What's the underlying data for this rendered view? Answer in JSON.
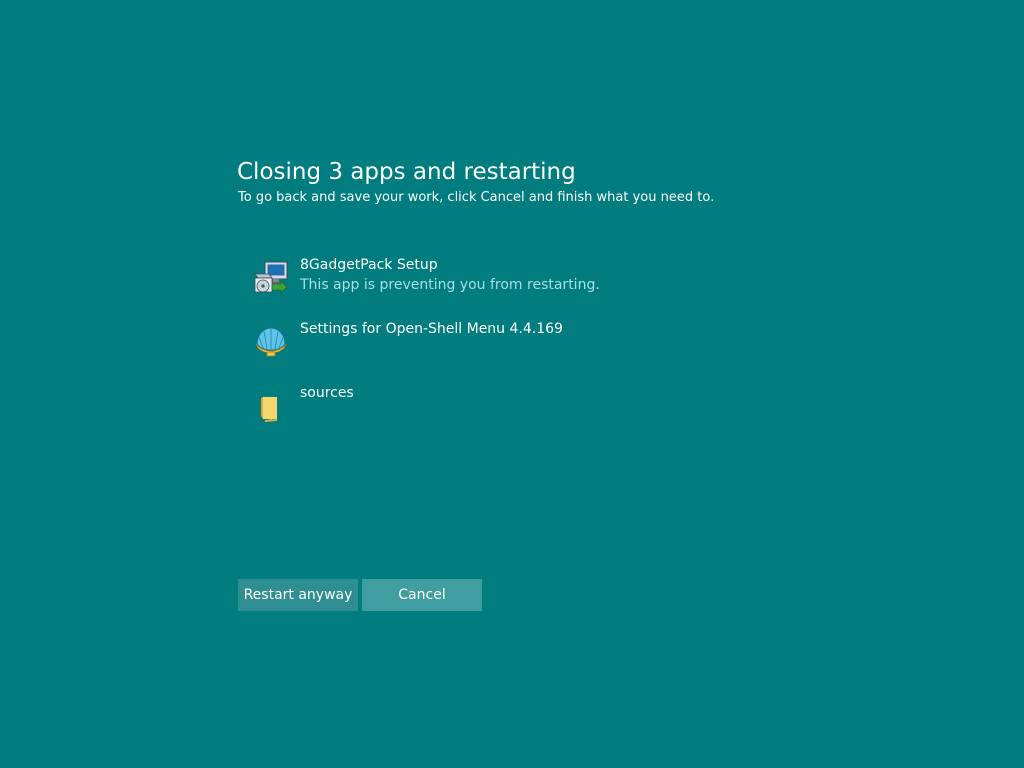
{
  "dialog": {
    "title": "Closing 3 apps and restarting",
    "subtitle": "To go back and save your work, click Cancel and finish what you need to."
  },
  "apps": [
    {
      "icon": "installer-icon",
      "name": "8GadgetPack Setup",
      "status": "This app is preventing you from restarting."
    },
    {
      "icon": "open-shell-icon",
      "name": "Settings for Open-Shell Menu 4.4.169",
      "status": ""
    },
    {
      "icon": "folder-icon",
      "name": "sources",
      "status": ""
    }
  ],
  "buttons": {
    "restart_label": "Restart anyway",
    "cancel_label": "Cancel"
  },
  "colors": {
    "background": "#017c7f",
    "status_text": "#a9dfe2",
    "restart_button": "#2e8e91",
    "cancel_button": "#409da0"
  }
}
